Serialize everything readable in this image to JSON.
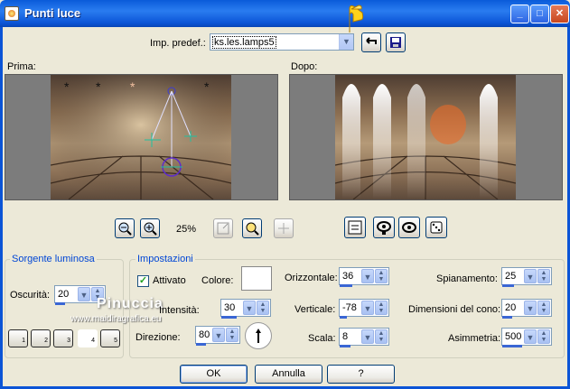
{
  "window": {
    "title": "Punti luce"
  },
  "preset": {
    "label": "Imp. predef.:",
    "value": "ks.les.lamps5"
  },
  "before": {
    "label": "Prima:"
  },
  "after": {
    "label": "Dopo:"
  },
  "zoom": {
    "value": "25%"
  },
  "light_source": {
    "group_title": "Sorgente luminosa",
    "darkness_label": "Oscurità:",
    "darkness_value": "20",
    "lamps": [
      "1",
      "2",
      "3",
      "4",
      "5"
    ]
  },
  "settings": {
    "group_title": "Impostazioni",
    "enabled_label": "Attivato",
    "color_label": "Colore:",
    "color": "#ffffff",
    "intensity_label": "Intensità:",
    "intensity_value": "30",
    "direction_label": "Direzione:",
    "direction_value": "80",
    "horizontal_label": "Orizzontale:",
    "horizontal_value": "36",
    "vertical_label": "Verticale:",
    "vertical_value": "-78",
    "scale_label": "Scala:",
    "scale_value": "8",
    "flatten_label": "Spianamento:",
    "flatten_value": "25",
    "cone_label": "Dimensioni del cono:",
    "cone_value": "20",
    "asym_label": "Asimmetria:",
    "asym_value": "500"
  },
  "buttons": {
    "ok": "OK",
    "cancel": "Annulla",
    "help": "?"
  },
  "watermark": {
    "line1": "Pinuccia",
    "line2": "www.maidiragrafica.eu"
  }
}
